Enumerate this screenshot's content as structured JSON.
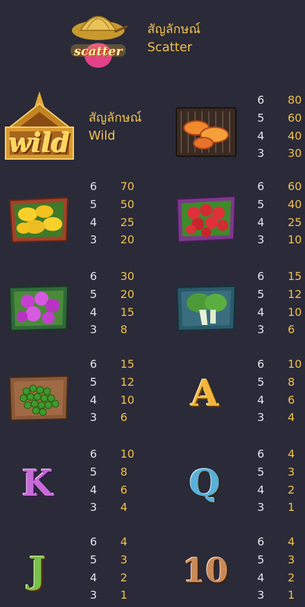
{
  "scatter": {
    "icon": "straw-hat-scatter-icon",
    "logo_text": "scatter",
    "label_thai": "สัญลักษณ์",
    "label_en": "Scatter"
  },
  "wild": {
    "icon": "golden-temple-wild-icon",
    "logo_text": "wild",
    "label_thai": "สัญลักษณ์",
    "label_en": "Wild"
  },
  "symbols": [
    {
      "id": "grilled-shrimp",
      "icon": "grilled-shrimp-icon",
      "pays": [
        {
          "count": "6",
          "value": "80"
        },
        {
          "count": "5",
          "value": "60"
        },
        {
          "count": "4",
          "value": "40"
        },
        {
          "count": "3",
          "value": "30"
        }
      ]
    },
    {
      "id": "mango",
      "icon": "mango-basket-icon",
      "pays": [
        {
          "count": "6",
          "value": "70"
        },
        {
          "count": "5",
          "value": "50"
        },
        {
          "count": "4",
          "value": "25"
        },
        {
          "count": "3",
          "value": "20"
        }
      ]
    },
    {
      "id": "rose-apple",
      "icon": "rose-apple-basket-icon",
      "pays": [
        {
          "count": "6",
          "value": "60"
        },
        {
          "count": "5",
          "value": "40"
        },
        {
          "count": "4",
          "value": "25"
        },
        {
          "count": "3",
          "value": "10"
        }
      ]
    },
    {
      "id": "orchid",
      "icon": "orchid-basket-icon",
      "pays": [
        {
          "count": "6",
          "value": "30"
        },
        {
          "count": "5",
          "value": "20"
        },
        {
          "count": "4",
          "value": "15"
        },
        {
          "count": "3",
          "value": "8"
        }
      ]
    },
    {
      "id": "bok-choy",
      "icon": "bok-choy-icon",
      "pays": [
        {
          "count": "6",
          "value": "15"
        },
        {
          "count": "5",
          "value": "12"
        },
        {
          "count": "4",
          "value": "10"
        },
        {
          "count": "3",
          "value": "6"
        }
      ]
    },
    {
      "id": "peas",
      "icon": "peas-basket-icon",
      "pays": [
        {
          "count": "6",
          "value": "15"
        },
        {
          "count": "5",
          "value": "12"
        },
        {
          "count": "4",
          "value": "10"
        },
        {
          "count": "3",
          "value": "6"
        }
      ]
    },
    {
      "id": "A",
      "icon": "letter-a-icon",
      "glyph": "A",
      "pays": [
        {
          "count": "6",
          "value": "10"
        },
        {
          "count": "5",
          "value": "8"
        },
        {
          "count": "4",
          "value": "6"
        },
        {
          "count": "3",
          "value": "4"
        }
      ]
    },
    {
      "id": "K",
      "icon": "letter-k-icon",
      "glyph": "K",
      "pays": [
        {
          "count": "6",
          "value": "10"
        },
        {
          "count": "5",
          "value": "8"
        },
        {
          "count": "4",
          "value": "6"
        },
        {
          "count": "3",
          "value": "4"
        }
      ]
    },
    {
      "id": "Q",
      "icon": "letter-q-icon",
      "glyph": "Q",
      "pays": [
        {
          "count": "6",
          "value": "4"
        },
        {
          "count": "5",
          "value": "3"
        },
        {
          "count": "4",
          "value": "2"
        },
        {
          "count": "3",
          "value": "1"
        }
      ]
    },
    {
      "id": "J",
      "icon": "letter-j-icon",
      "glyph": "J",
      "pays": [
        {
          "count": "6",
          "value": "4"
        },
        {
          "count": "5",
          "value": "3"
        },
        {
          "count": "4",
          "value": "2"
        },
        {
          "count": "3",
          "value": "1"
        }
      ]
    },
    {
      "id": "10",
      "icon": "number-10-icon",
      "glyph": "10",
      "pays": [
        {
          "count": "6",
          "value": "4"
        },
        {
          "count": "5",
          "value": "3"
        },
        {
          "count": "4",
          "value": "2"
        },
        {
          "count": "3",
          "value": "1"
        }
      ]
    }
  ],
  "colors": {
    "background": "#2a2a38",
    "value": "#f2c14e",
    "count": "#e4e4ea"
  }
}
